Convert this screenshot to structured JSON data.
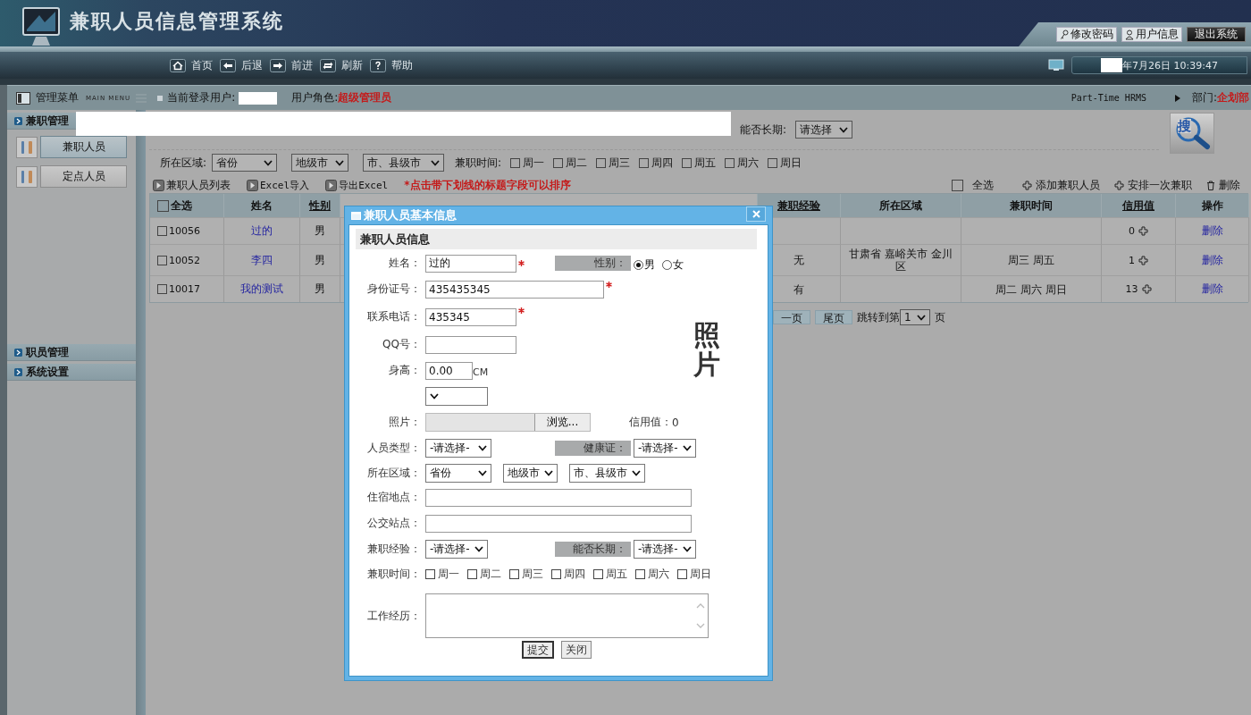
{
  "header": {
    "title": "兼职人员信息管理系统",
    "top_buttons": [
      {
        "label": "修改密码",
        "kind": "key"
      },
      {
        "label": "用户信息",
        "kind": "user"
      },
      {
        "label": "退出系统",
        "kind": "exit"
      }
    ],
    "nav": [
      {
        "label": "首页",
        "kind": "home"
      },
      {
        "label": "后退",
        "kind": "back"
      },
      {
        "label": "前进",
        "kind": "forward"
      },
      {
        "label": "刷新",
        "kind": "refresh"
      },
      {
        "label": "帮助",
        "kind": "help"
      }
    ],
    "datetime": "年7月26日 10:39:47"
  },
  "info_bar": {
    "menu_title": "管理菜单",
    "menu_subtitle": "MAIN MENU",
    "login_label": "当前登录用户:",
    "role_label": "用户角色:",
    "role": "超级管理员",
    "system": "Part-Time HRMS",
    "dept_label": "部门:",
    "dept": "企划部"
  },
  "sidebar": {
    "groups": [
      {
        "label": "兼职管理",
        "items": [
          {
            "label": "兼职人员",
            "selected": true
          },
          {
            "label": "定点人员",
            "selected": false
          }
        ]
      },
      {
        "label": "职员管理"
      },
      {
        "label": "系统设置"
      }
    ]
  },
  "filters": {
    "long_term": {
      "label": "能否长期:",
      "value": "请选择"
    },
    "region": {
      "label": "所在区域:",
      "selects": [
        "省份",
        "地级市",
        "市、县级市"
      ]
    },
    "time": {
      "label": "兼职时间:",
      "days": [
        {
          "label": "周一",
          "checked": false
        },
        {
          "label": "周二",
          "checked": false
        },
        {
          "label": "周三",
          "checked": false
        },
        {
          "label": "周四",
          "checked": false
        },
        {
          "label": "周五",
          "checked": false
        },
        {
          "label": "周六",
          "checked": false
        },
        {
          "label": "周日",
          "checked": false
        }
      ]
    },
    "search": "搜"
  },
  "toolbar": {
    "links": [
      "兼职人员列表",
      "Excel导入",
      "导出Excel"
    ],
    "note": "*点击带下划线的标题字段可以排序",
    "select_all": {
      "label": "全选",
      "checked": false
    },
    "actions": [
      {
        "label": "添加兼职人员",
        "kind": "add"
      },
      {
        "label": "安排一次兼职",
        "kind": "add"
      },
      {
        "label": "删除",
        "kind": "delete"
      }
    ]
  },
  "table": {
    "columns": [
      {
        "label": "全选",
        "kind": "check",
        "sortable": false
      },
      {
        "label": "姓名",
        "sortable": false
      },
      {
        "label": "性别",
        "sortable": true
      },
      {
        "label": "兼职经验",
        "sortable": true
      },
      {
        "label": "所在区域",
        "sortable": false
      },
      {
        "label": "兼职时间",
        "sortable": false
      },
      {
        "label": "信用值",
        "sortable": true
      },
      {
        "label": "操作",
        "sortable": false
      }
    ],
    "rows": [
      {
        "checked": false,
        "id": "10056",
        "name": "过的",
        "gender": "男",
        "credit": "0",
        "action": "删除"
      },
      {
        "checked": false,
        "id": "10052",
        "name": "李四",
        "gender": "男",
        "experience": "无",
        "region": "甘肃省 嘉峪关市 金川区",
        "time": "周三 周五",
        "credit": "1",
        "action": "删除"
      },
      {
        "checked": false,
        "id": "10017",
        "name": "我的测试",
        "gender": "男",
        "experience": "有",
        "time": "周二 周六 周日",
        "credit": "13",
        "action": "删除"
      }
    ]
  },
  "pagination": {
    "next_partial": "一页",
    "last": "尾页",
    "jump_label": "跳转到第",
    "page": "1",
    "page_suffix": "页"
  },
  "dialog": {
    "title": "兼职人员基本信息",
    "section": "兼职人员信息",
    "name": {
      "label": "姓名：",
      "value": "过的",
      "required": true
    },
    "gender": {
      "label": "性别：",
      "options": [
        {
          "label": "男",
          "selected": true
        },
        {
          "label": "女",
          "selected": false
        }
      ]
    },
    "id_number": {
      "label": "身份证号：",
      "value": "435435345",
      "required": true
    },
    "phone": {
      "label": "联系电话：",
      "value": "435345",
      "required": true
    },
    "qq": {
      "label": "QQ号："
    },
    "height": {
      "label": "身高：",
      "value": "0.00",
      "unit": "CM"
    },
    "photo_placeholder": "照片",
    "photo": {
      "label": "照片：",
      "button": "浏览..."
    },
    "credit": {
      "label": "信用值：",
      "value": "0"
    },
    "person_type": {
      "label": "人员类型：",
      "value": "-请选择-"
    },
    "health": {
      "label": "健康证：",
      "value": "-请选择-"
    },
    "region": {
      "label": "所在区域：",
      "selects": [
        "省份",
        "地级市",
        "市、县级市"
      ]
    },
    "lodging": {
      "label": "住宿地点："
    },
    "bus_stop": {
      "label": "公交站点："
    },
    "experience": {
      "label": "兼职经验：",
      "value": "-请选择-"
    },
    "long_term": {
      "label": "能否长期：",
      "value": "-请选择-"
    },
    "work_time": {
      "label": "兼职时间：",
      "days": [
        {
          "label": "周一",
          "checked": false
        },
        {
          "label": "周二",
          "checked": false
        },
        {
          "label": "周三",
          "checked": false
        },
        {
          "label": "周四",
          "checked": false
        },
        {
          "label": "周五",
          "checked": false
        },
        {
          "label": "周六",
          "checked": false
        },
        {
          "label": "周日",
          "checked": false
        }
      ]
    },
    "work_history": {
      "label": "工作经历："
    },
    "buttons": [
      {
        "label": "提交",
        "focused": true
      },
      {
        "label": "关闭",
        "focused": false
      }
    ]
  }
}
